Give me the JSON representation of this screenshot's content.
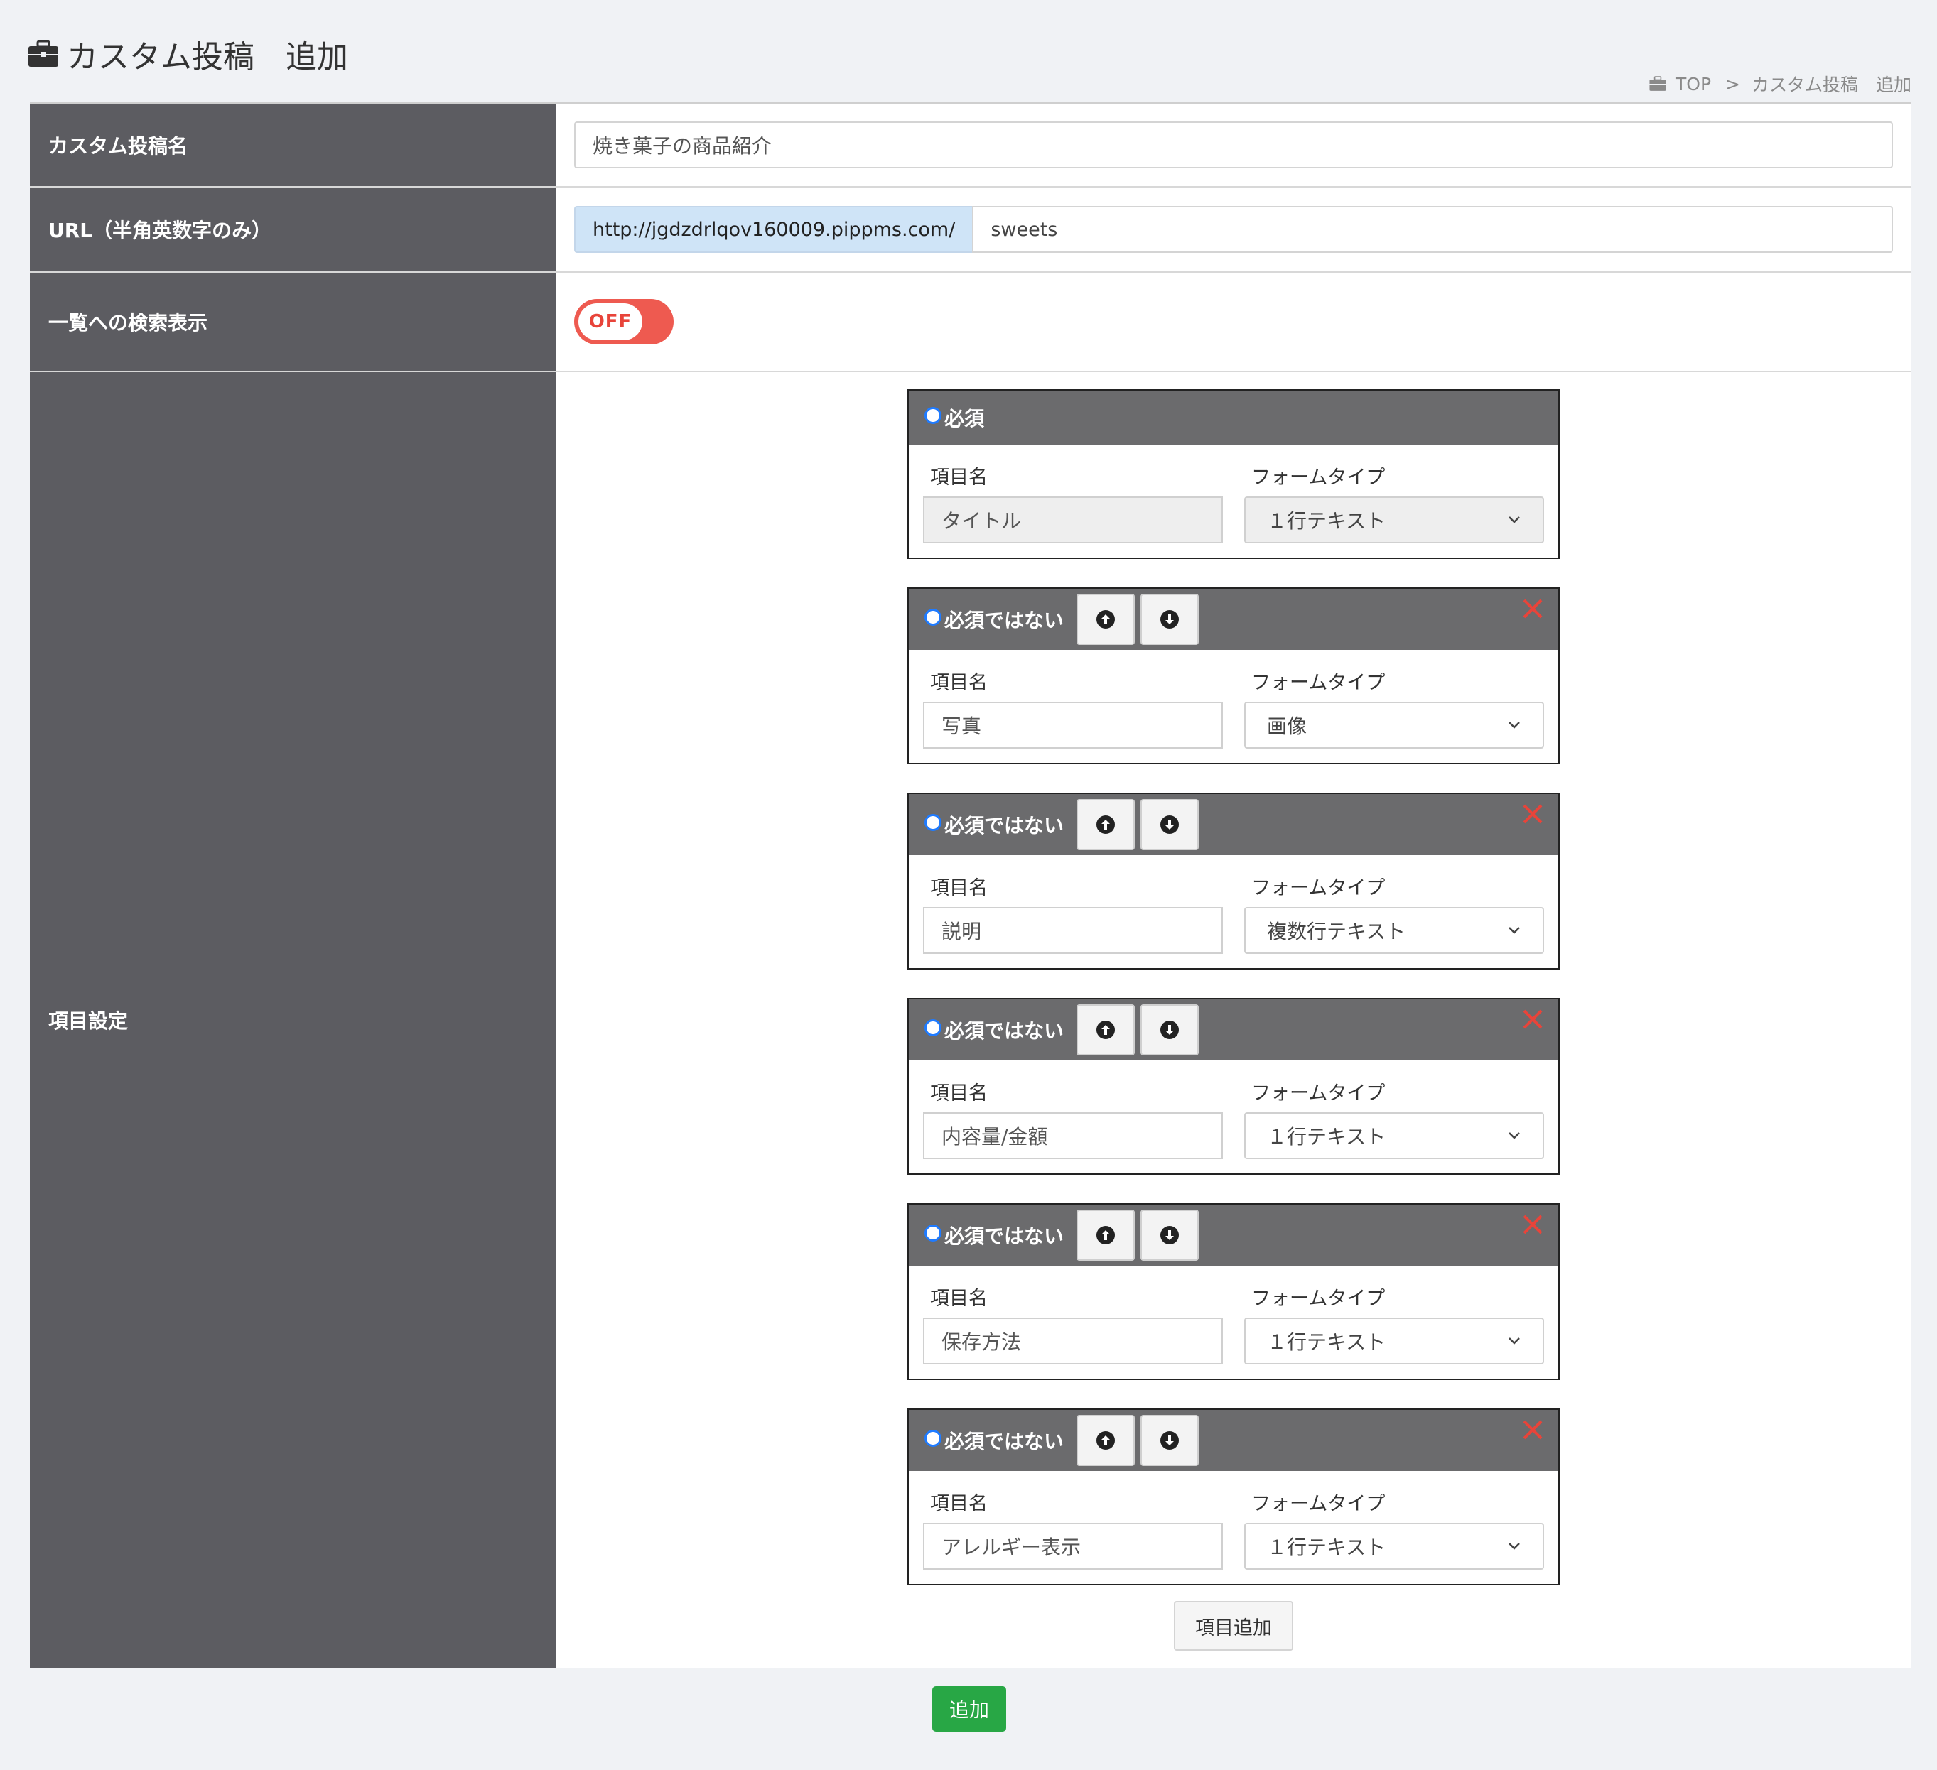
{
  "header": {
    "title": "カスタム投稿　追加",
    "icon": "briefcase-icon"
  },
  "breadcrumb": {
    "home": "TOP",
    "separator": ">",
    "current": "カスタム投稿　追加"
  },
  "form": {
    "name_label": "カスタム投稿名",
    "name_value": "焼き菓子の商品紹介",
    "url_label": "URL（半角英数字のみ）",
    "url_prefix": "http://jgdzdrlqov160009.pippms.com/",
    "url_value": "sweets",
    "search_label": "一覧への検索表示",
    "search_toggle": "OFF",
    "items_label": "項目設定"
  },
  "items": [
    {
      "required_label": "必須",
      "name_label": "項目名",
      "name_value": "タイトル",
      "type_label": "フォームタイプ",
      "type_value": "１行テキスト"
    },
    {
      "required_label": "必須ではない",
      "name_label": "項目名",
      "name_value": "写真",
      "type_label": "フォームタイプ",
      "type_value": "画像"
    },
    {
      "required_label": "必須ではない",
      "name_label": "項目名",
      "name_value": "説明",
      "type_label": "フォームタイプ",
      "type_value": "複数行テキスト"
    },
    {
      "required_label": "必須ではない",
      "name_label": "項目名",
      "name_value": "内容量/金額",
      "type_label": "フォームタイプ",
      "type_value": "１行テキスト"
    },
    {
      "required_label": "必須ではない",
      "name_label": "項目名",
      "name_value": "保存方法",
      "type_label": "フォームタイプ",
      "type_value": "１行テキスト"
    },
    {
      "required_label": "必須ではない",
      "name_label": "項目名",
      "name_value": "アレルギー表示",
      "type_label": "フォームタイプ",
      "type_value": "１行テキスト"
    }
  ],
  "actions": {
    "add_item": "項目追加",
    "submit": "追加"
  },
  "colors": {
    "label_bg": "#5c5c61",
    "item_header_bg": "#6b6b6d",
    "toggle_off": "#ee5a50",
    "submit": "#28a745",
    "url_prefix_bg": "#cfe4f7",
    "close_icon": "#e8443a"
  }
}
